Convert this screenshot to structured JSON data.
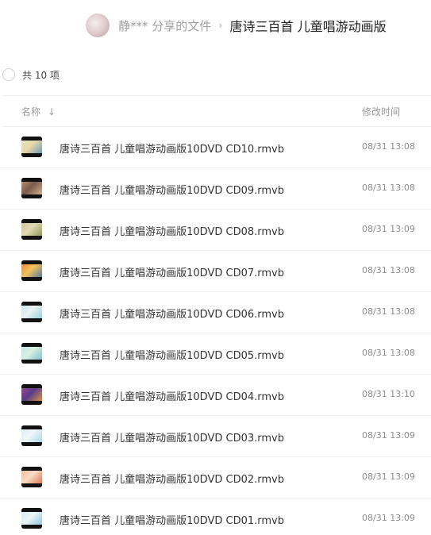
{
  "breadcrumb": {
    "owner": "静*** 分享的文件",
    "separator": "›",
    "current": "唐诗三百首 儿童唱游动画版"
  },
  "summary": {
    "count_label": "共 10 项"
  },
  "columns": {
    "name": "名称",
    "time": "修改时间"
  },
  "icons": {
    "sort": "arrow-down-icon",
    "select_all": "circle-checkbox-icon"
  },
  "files": [
    {
      "name": "唐诗三百首 儿童唱游动画版10DVD CD10.rmvb",
      "time": "08/31 13:08",
      "thumb_colors": [
        "#d9e8c9",
        "#5a8fb8",
        "#e9d7a8"
      ]
    },
    {
      "name": "唐诗三百首 儿童唱游动画版10DVD CD09.rmvb",
      "time": "08/31 13:08",
      "thumb_colors": [
        "#c99a7a",
        "#e6c3a2",
        "#7a5b4a"
      ]
    },
    {
      "name": "唐诗三百首 儿童唱游动画版10DVD CD08.rmvb",
      "time": "08/31 13:09",
      "thumb_colors": [
        "#c7b890",
        "#7c8c4a",
        "#e4dab5"
      ]
    },
    {
      "name": "唐诗三百首 儿童唱游动画版10DVD CD07.rmvb",
      "time": "08/31 13:08",
      "thumb_colors": [
        "#e87b3a",
        "#3a6aa8",
        "#f3c15a"
      ]
    },
    {
      "name": "唐诗三百首 儿童唱游动画版10DVD CD06.rmvb",
      "time": "08/31 13:08",
      "thumb_colors": [
        "#bfe3ef",
        "#8cc6d8",
        "#e8f2f2"
      ]
    },
    {
      "name": "唐诗三百首 儿童唱游动画版10DVD CD05.rmvb",
      "time": "08/31 13:08",
      "thumb_colors": [
        "#bde3ec",
        "#6fb7c9",
        "#d8efe0"
      ]
    },
    {
      "name": "唐诗三百首 儿童唱游动画版10DVD CD04.rmvb",
      "time": "08/31 13:10",
      "thumb_colors": [
        "#b0488a",
        "#f0a83c",
        "#5a3a8a"
      ]
    },
    {
      "name": "唐诗三百首 儿童唱游动画版10DVD CD03.rmvb",
      "time": "08/31 13:09",
      "thumb_colors": [
        "#d6eef5",
        "#9bcfe0",
        "#eef7f8"
      ]
    },
    {
      "name": "唐诗三百首 儿童唱游动画版10DVD CD02.rmvb",
      "time": "08/31 13:09",
      "thumb_colors": [
        "#f0b48a",
        "#d9653c",
        "#f7dcc4"
      ]
    },
    {
      "name": "唐诗三百首 儿童唱游动画版10DVD CD01.rmvb",
      "time": "08/31 13:09",
      "thumb_colors": [
        "#cfe9f3",
        "#7fbcd6",
        "#e9f5f6"
      ]
    }
  ]
}
